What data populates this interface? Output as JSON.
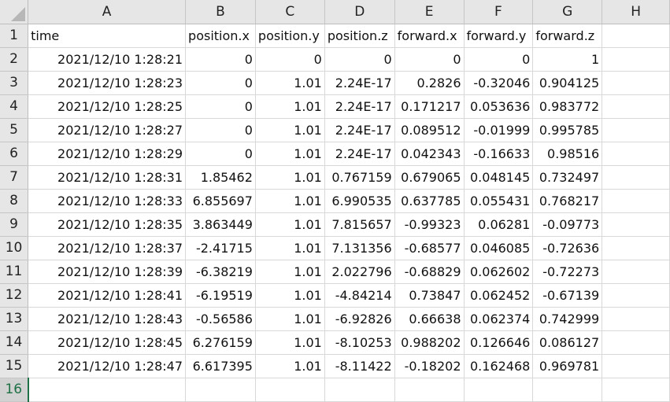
{
  "columns": [
    "A",
    "B",
    "C",
    "D",
    "E",
    "F",
    "G",
    "H"
  ],
  "headers": [
    "time",
    "position.x",
    "position.y",
    "position.z",
    "forward.x",
    "forward.y",
    "forward.z"
  ],
  "rows": [
    [
      "2021/12/10 1:28:21",
      "0",
      "0",
      "0",
      "0",
      "0",
      "1"
    ],
    [
      "2021/12/10 1:28:23",
      "0",
      "1.01",
      "2.24E-17",
      "0.2826",
      "-0.32046",
      "0.904125"
    ],
    [
      "2021/12/10 1:28:25",
      "0",
      "1.01",
      "2.24E-17",
      "0.171217",
      "0.053636",
      "0.983772"
    ],
    [
      "2021/12/10 1:28:27",
      "0",
      "1.01",
      "2.24E-17",
      "0.089512",
      "-0.01999",
      "0.995785"
    ],
    [
      "2021/12/10 1:28:29",
      "0",
      "1.01",
      "2.24E-17",
      "0.042343",
      "-0.16633",
      "0.98516"
    ],
    [
      "2021/12/10 1:28:31",
      "1.85462",
      "1.01",
      "0.767159",
      "0.679065",
      "0.048145",
      "0.732497"
    ],
    [
      "2021/12/10 1:28:33",
      "6.855697",
      "1.01",
      "6.990535",
      "0.637785",
      "0.055431",
      "0.768217"
    ],
    [
      "2021/12/10 1:28:35",
      "3.863449",
      "1.01",
      "7.815657",
      "-0.99323",
      "0.06281",
      "-0.09773"
    ],
    [
      "2021/12/10 1:28:37",
      "-2.41715",
      "1.01",
      "7.131356",
      "-0.68577",
      "0.046085",
      "-0.72636"
    ],
    [
      "2021/12/10 1:28:39",
      "-6.38219",
      "1.01",
      "2.022796",
      "-0.68829",
      "0.062602",
      "-0.72273"
    ],
    [
      "2021/12/10 1:28:41",
      "-6.19519",
      "1.01",
      "-4.84214",
      "0.73847",
      "0.062452",
      "-0.67139"
    ],
    [
      "2021/12/10 1:28:43",
      "-0.56586",
      "1.01",
      "-6.92826",
      "0.66638",
      "0.062374",
      "0.742999"
    ],
    [
      "2021/12/10 1:28:45",
      "6.276159",
      "1.01",
      "-8.10253",
      "0.988202",
      "0.126646",
      "0.086127"
    ],
    [
      "2021/12/10 1:28:47",
      "6.617395",
      "1.01",
      "-8.11422",
      "-0.18202",
      "0.162468",
      "0.969781"
    ]
  ],
  "row_numbers": [
    "1",
    "2",
    "3",
    "4",
    "5",
    "6",
    "7",
    "8",
    "9",
    "10",
    "11",
    "12",
    "13",
    "14",
    "15",
    "16"
  ],
  "active_row": "16",
  "colors": {
    "header_bg": "#e6e6e6",
    "active_row_accent": "#1e7145",
    "gridline": "#d8d8d8"
  }
}
